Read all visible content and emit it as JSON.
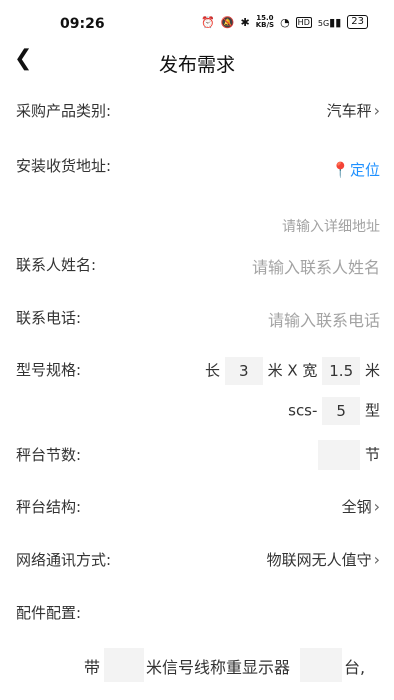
{
  "status": {
    "time": "09:26",
    "net_speed": "15.0",
    "net_unit": "KB/S",
    "hd": "HD",
    "signal": "5G",
    "battery": "23"
  },
  "header": {
    "title": "发布需求"
  },
  "form": {
    "category": {
      "label": "采购产品类别:",
      "value": "汽车秤"
    },
    "address": {
      "label": "安装收货地址:",
      "locate": "定位",
      "detail_placeholder": "请输入详细地址"
    },
    "contact": {
      "label": "联系人姓名:",
      "placeholder": "请输入联系人姓名"
    },
    "phone": {
      "label": "联系电话:",
      "placeholder": "请输入联系电话"
    },
    "model": {
      "label": "型号规格:",
      "len_prefix": "长",
      "length": "3",
      "mid": "米 X 宽",
      "width": "1.5",
      "unit": "米",
      "code_prefix": "scs-",
      "code": "5",
      "code_suffix": "型"
    },
    "sections": {
      "label": "秤台节数:",
      "value": "",
      "unit": "节"
    },
    "structure": {
      "label": "秤台结构:",
      "value": "全钢"
    },
    "network": {
      "label": "网络通讯方式:",
      "value": "物联网无人值守"
    },
    "accessories": {
      "label": "配件配置:",
      "prefix": "带",
      "cable_value": "",
      "middle": "米信号线称重显示器",
      "display_value": "",
      "suffix": "台,"
    }
  }
}
